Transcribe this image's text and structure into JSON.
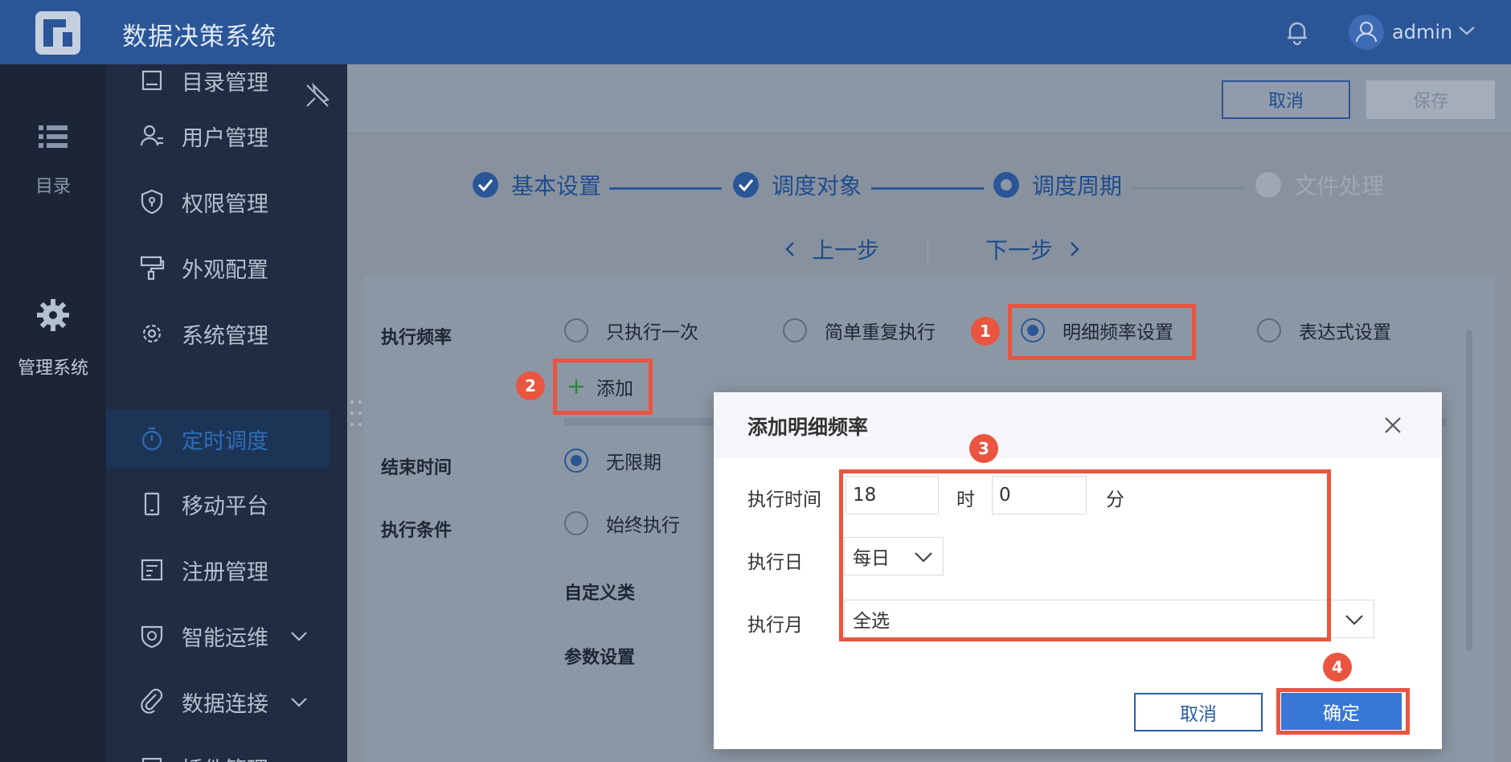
{
  "header": {
    "app_title": "数据决策系统",
    "user_name": "admin"
  },
  "rail": {
    "items": [
      {
        "label": "目录",
        "icon": "list-icon"
      },
      {
        "label": "管理系统",
        "icon": "gear-icon"
      }
    ]
  },
  "sidebar": {
    "items": [
      {
        "label": "目录管理",
        "icon": "directory-icon"
      },
      {
        "label": "用户管理",
        "icon": "user-icon"
      },
      {
        "label": "权限管理",
        "icon": "shield-icon"
      },
      {
        "label": "外观配置",
        "icon": "paint-roller-icon"
      },
      {
        "label": "系统管理",
        "icon": "gear-icon"
      },
      {
        "label": "定时调度",
        "icon": "stopwatch-icon",
        "active": true
      },
      {
        "label": "移动平台",
        "icon": "mobile-icon"
      },
      {
        "label": "注册管理",
        "icon": "register-icon"
      },
      {
        "label": "智能运维",
        "icon": "ops-icon",
        "expandable": true
      },
      {
        "label": "数据连接",
        "icon": "link-icon",
        "expandable": true
      },
      {
        "label": "插件管理",
        "icon": "plugin-icon"
      }
    ]
  },
  "toolbar": {
    "cancel_label": "取消",
    "save_label": "保存"
  },
  "steps": [
    {
      "label": "基本设置",
      "state": "done"
    },
    {
      "label": "调度对象",
      "state": "done"
    },
    {
      "label": "调度周期",
      "state": "current"
    },
    {
      "label": "文件处理",
      "state": "pending"
    }
  ],
  "step_nav": {
    "prev_label": "上一步",
    "next_label": "下一步"
  },
  "form": {
    "frequency_label": "执行频率",
    "frequency_options": [
      "只执行一次",
      "简单重复执行",
      "明细频率设置",
      "表达式设置"
    ],
    "frequency_selected": "明细频率设置",
    "add_label": "添加",
    "end_time_label": "结束时间",
    "end_time_value": "无限期",
    "condition_label": "执行条件",
    "condition_value": "始终执行",
    "custom_class_label": "自定义类",
    "param_settings_label": "参数设置"
  },
  "modal": {
    "title": "添加明细频率",
    "exec_time_label": "执行时间",
    "hour_value": "18",
    "hour_unit": "时",
    "minute_value": "0",
    "minute_unit": "分",
    "exec_day_label": "执行日",
    "exec_day_value": "每日",
    "exec_month_label": "执行月",
    "exec_month_value": "全选",
    "cancel_label": "取消",
    "confirm_label": "确定"
  },
  "annotations": [
    "1",
    "2",
    "3",
    "4"
  ],
  "colors": {
    "accent": "#2a5698",
    "highlight": "#ea5540",
    "confirm": "#3877d6"
  }
}
